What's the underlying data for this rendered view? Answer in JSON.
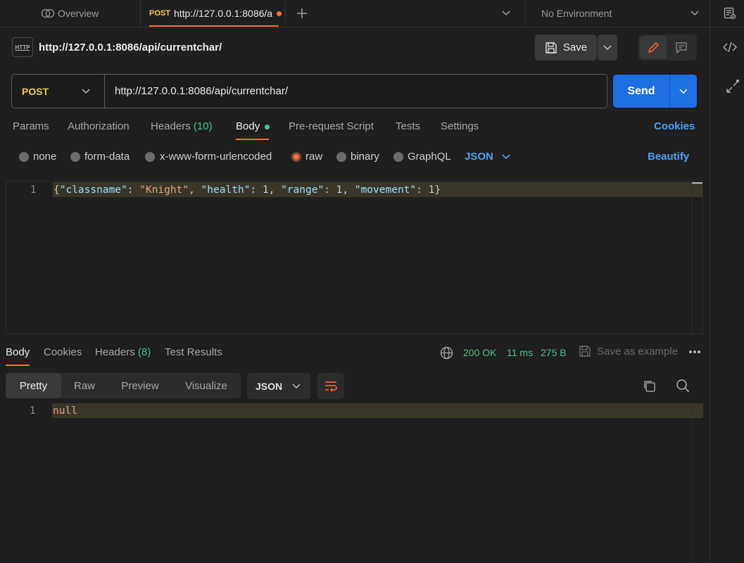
{
  "tabs": {
    "overview_label": "Overview",
    "active_method": "POST",
    "active_url": "http://127.0.0.1:8086/a",
    "environment": "No Environment"
  },
  "request": {
    "title": "http://127.0.0.1:8086/api/currentchar/",
    "http_badge": "HTTP",
    "save_label": "Save",
    "method": "POST",
    "url": "http://127.0.0.1:8086/api/currentchar/",
    "send_label": "Send"
  },
  "request_tabs": {
    "params": "Params",
    "authorization": "Authorization",
    "headers": "Headers",
    "headers_count": "(10)",
    "body": "Body",
    "pre_request": "Pre-request Script",
    "tests": "Tests",
    "settings": "Settings",
    "cookies": "Cookies"
  },
  "body_types": {
    "none": "none",
    "form_data": "form-data",
    "urlencoded": "x-www-form-urlencoded",
    "raw": "raw",
    "binary": "binary",
    "graphql": "GraphQL",
    "format": "JSON",
    "beautify": "Beautify"
  },
  "editor": {
    "line_number": "1",
    "code": {
      "open": "{",
      "k1": "\"classname\"",
      "v1": "\"Knight\"",
      "k2": "\"health\"",
      "v2": "1",
      "k3": "\"range\"",
      "v3": "1",
      "k4": "\"movement\"",
      "v4": "1",
      "close": "}"
    }
  },
  "response": {
    "tabs": {
      "body": "Body",
      "cookies": "Cookies",
      "headers": "Headers",
      "headers_count": "(8)",
      "test_results": "Test Results"
    },
    "status": "200 OK",
    "time": "11 ms",
    "size": "275 B",
    "save_example": "Save as example",
    "views": {
      "pretty": "Pretty",
      "raw": "Raw",
      "preview": "Preview",
      "visualize": "Visualize",
      "format": "JSON"
    },
    "line_number": "1",
    "body": "null"
  },
  "colors": {
    "accent_orange": "#ff6c37",
    "send_blue": "#1f6fe5",
    "link_blue": "#4a9ff5",
    "status_green": "#4cc38a",
    "method_yellow": "#f2c94c"
  }
}
